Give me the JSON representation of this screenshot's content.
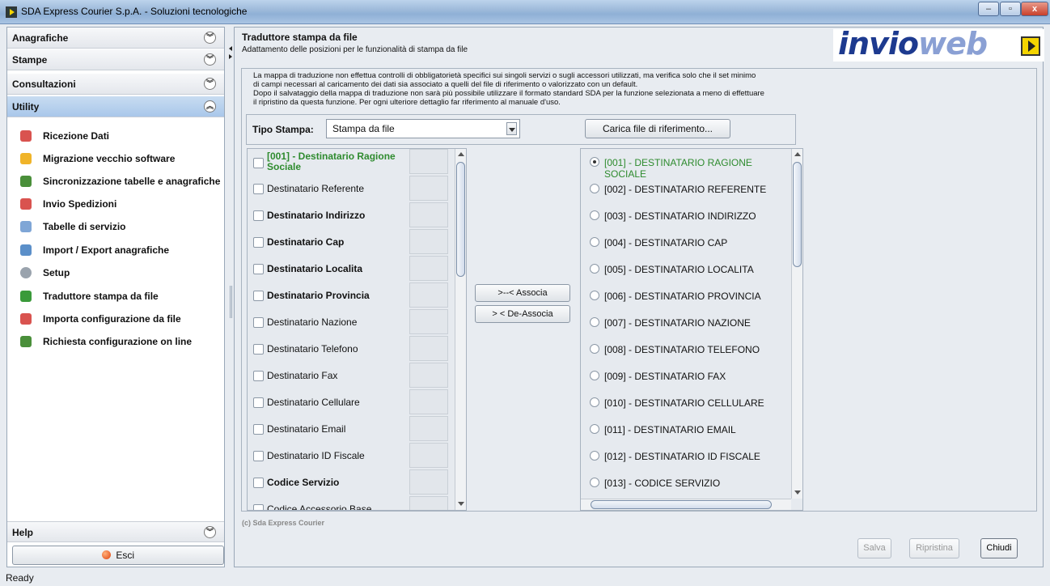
{
  "window": {
    "title": "SDA Express Courier S.p.A. - Soluzioni tecnologiche"
  },
  "sidebar": {
    "sections": [
      {
        "label": "Anagrafiche",
        "icon": "chevron-down-icon"
      },
      {
        "label": "Stampe",
        "icon": "chevron-down-icon"
      },
      {
        "label": "Consultazioni",
        "icon": "chevron-down-icon"
      },
      {
        "label": "Utility",
        "icon": "chevron-up-icon"
      }
    ],
    "utility_items": [
      {
        "label": "Ricezione Dati",
        "icon": "receive-data-icon",
        "color": "#d9534f"
      },
      {
        "label": "Migrazione vecchio software",
        "icon": "migration-icon",
        "color": "#f0b429"
      },
      {
        "label": "Sincronizzazione tabelle e anagrafiche",
        "icon": "sync-icon",
        "color": "#4a8f3a"
      },
      {
        "label": "Invio Spedizioni",
        "icon": "send-shipments-icon",
        "color": "#d9534f"
      },
      {
        "label": "Tabelle di servizio",
        "icon": "tables-icon",
        "color": "#7fa6d6"
      },
      {
        "label": "Import / Export anagrafiche",
        "icon": "import-export-icon",
        "color": "#5b8fc9"
      },
      {
        "label": "Setup",
        "icon": "gear-icon",
        "color": "#9aa3ad"
      },
      {
        "label": "Traduttore stampa da file",
        "icon": "translator-icon",
        "color": "#3a9a3a"
      },
      {
        "label": "Importa configurazione da file",
        "icon": "import-config-icon",
        "color": "#d9534f"
      },
      {
        "label": "Richiesta configurazione on line",
        "icon": "online-config-icon",
        "color": "#4a8f3a"
      }
    ],
    "help": {
      "label": "Help",
      "icon": "chevron-down-icon"
    },
    "esci_label": "Esci"
  },
  "main": {
    "title": "Traduttore stampa da file",
    "subtitle": "Adattamento delle posizioni per le funzionalità di stampa da file",
    "logo_text_a": "invio",
    "logo_text_b": "web",
    "info_lines": [
      "La mappa di traduzione non effettua controlli di obbligatorietà  specifici sui singoli servizi o sugli accessori utilizzati, ma verifica solo che il set minimo",
      "di campi necessari al caricamento dei dati sia associato a quelli del file di riferimento o valorizzato con un default.",
      "Dopo il salvataggio della mappa di traduzione non sarà più possibile utilizzare il formato standard SDA per la funzione selezionata a meno di effettuare",
      "il ripristino da questa funzione. Per ogni ulteriore dettaglio far riferimento al manuale d'uso."
    ],
    "tipo_stampa_label": "Tipo Stampa:",
    "tipo_stampa_value": "Stampa da file",
    "carica_label": "Carica file di riferimento...",
    "associa_label": ">--< Associa",
    "deassocia_label": "> < De-Associa",
    "left_fields": [
      {
        "label": "[001] - Destinatario Ragione Sociale",
        "bold": true,
        "color": "#2e8b2e"
      },
      {
        "label": "Destinatario Referente",
        "bold": false
      },
      {
        "label": "Destinatario Indirizzo",
        "bold": true
      },
      {
        "label": "Destinatario Cap",
        "bold": true
      },
      {
        "label": "Destinatario Localita",
        "bold": true
      },
      {
        "label": "Destinatario Provincia",
        "bold": true
      },
      {
        "label": "Destinatario Nazione",
        "bold": false
      },
      {
        "label": "Destinatario Telefono",
        "bold": false
      },
      {
        "label": "Destinatario Fax",
        "bold": false
      },
      {
        "label": "Destinatario Cellulare",
        "bold": false
      },
      {
        "label": "Destinatario Email",
        "bold": false
      },
      {
        "label": "Destinatario ID Fiscale",
        "bold": false
      },
      {
        "label": "Codice Servizio",
        "bold": true
      },
      {
        "label": "Codice Accessorio Base",
        "bold": false
      }
    ],
    "right_fields": [
      "[001] - DESTINATARIO RAGIONE SOCIALE",
      "[002] - DESTINATARIO REFERENTE",
      "[003] - DESTINATARIO INDIRIZZO",
      "[004] - DESTINATARIO CAP",
      "[005] - DESTINATARIO LOCALITA",
      "[006] - DESTINATARIO PROVINCIA",
      "[007] - DESTINATARIO NAZIONE",
      "[008] - DESTINATARIO TELEFONO",
      "[009] - DESTINATARIO FAX",
      "[010] - DESTINATARIO CELLULARE",
      "[011] - DESTINATARIO EMAIL",
      "[012] - DESTINATARIO ID FISCALE",
      "[013] - CODICE SERVIZIO"
    ],
    "right_selected_color": "#2e8b2e",
    "copyright": "(c) Sda Express Courier",
    "salva_label": "Salva",
    "ripristina_label": "Ripristina",
    "chiudi_label": "Chiudi"
  },
  "status": "Ready"
}
